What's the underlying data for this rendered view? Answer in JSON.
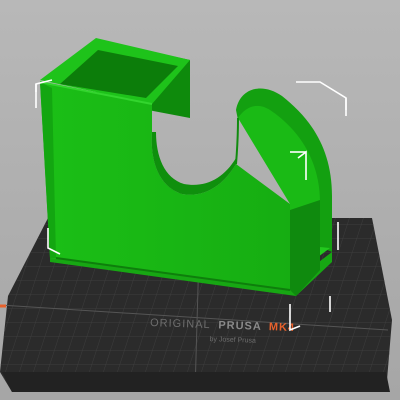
{
  "bed": {
    "brand_prefix": "ORIGINAL",
    "brand_name": "PRUSA",
    "model": "MK4",
    "byline": "by Josef Prusa"
  },
  "colors": {
    "background": "#a9a9a9",
    "bed": "#2b2b2b",
    "bed_grid": "#3e3e3e",
    "model_green": "#19b514",
    "model_green_dark": "#0f8a0e",
    "model_green_light": "#23c51f",
    "accent_orange": "#e8612c",
    "selection_box": "#ffffff"
  },
  "model": {
    "selected": true
  }
}
